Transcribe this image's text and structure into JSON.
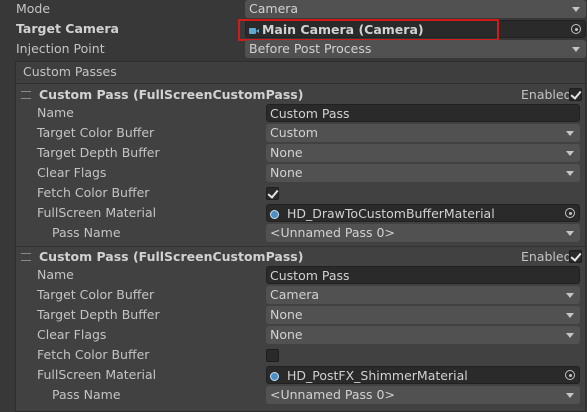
{
  "fields": {
    "mode": {
      "label": "Mode",
      "value": "Camera"
    },
    "target_camera": {
      "label": "Target Camera",
      "value": "Main Camera (Camera)"
    },
    "injection_point": {
      "label": "Injection Point",
      "value": "Before Post Process"
    }
  },
  "custom_passes": {
    "header": "Custom Passes",
    "passes": [
      {
        "title": "Custom Pass (FullScreenCustomPass)",
        "enabled_label": "Enabled",
        "enabled": true,
        "name_label": "Name",
        "name": "Custom Pass",
        "target_color_label": "Target Color Buffer",
        "target_color": "Custom",
        "target_depth_label": "Target Depth Buffer",
        "target_depth": "None",
        "clear_flags_label": "Clear Flags",
        "clear_flags": "None",
        "fetch_color_label": "Fetch Color Buffer",
        "fetch_color": true,
        "material_label": "FullScreen Material",
        "material": "HD_DrawToCustomBufferMaterial",
        "pass_name_label": "Pass Name",
        "pass_name": "<Unnamed Pass 0>"
      },
      {
        "title": "Custom Pass (FullScreenCustomPass)",
        "enabled_label": "Enabled",
        "enabled": true,
        "name_label": "Name",
        "name": "Custom Pass",
        "target_color_label": "Target Color Buffer",
        "target_color": "Camera",
        "target_depth_label": "Target Depth Buffer",
        "target_depth": "None",
        "clear_flags_label": "Clear Flags",
        "clear_flags": "None",
        "fetch_color_label": "Fetch Color Buffer",
        "fetch_color": false,
        "material_label": "FullScreen Material",
        "material": "HD_PostFX_ShimmerMaterial",
        "pass_name_label": "Pass Name",
        "pass_name": "<Unnamed Pass 0>"
      }
    ]
  },
  "icons": {
    "camera": "camera-icon",
    "material": "material-sphere-icon",
    "picker": "object-picker-icon",
    "dropdown": "chevron-down-icon",
    "reorder": "reorder-handle-icon",
    "check": "checkmark-icon"
  },
  "colors": {
    "background": "#383838",
    "highlight_box": "#d11a1a",
    "camera_icon": "#5fa8d3",
    "material_icon": "#4c8fc4"
  }
}
